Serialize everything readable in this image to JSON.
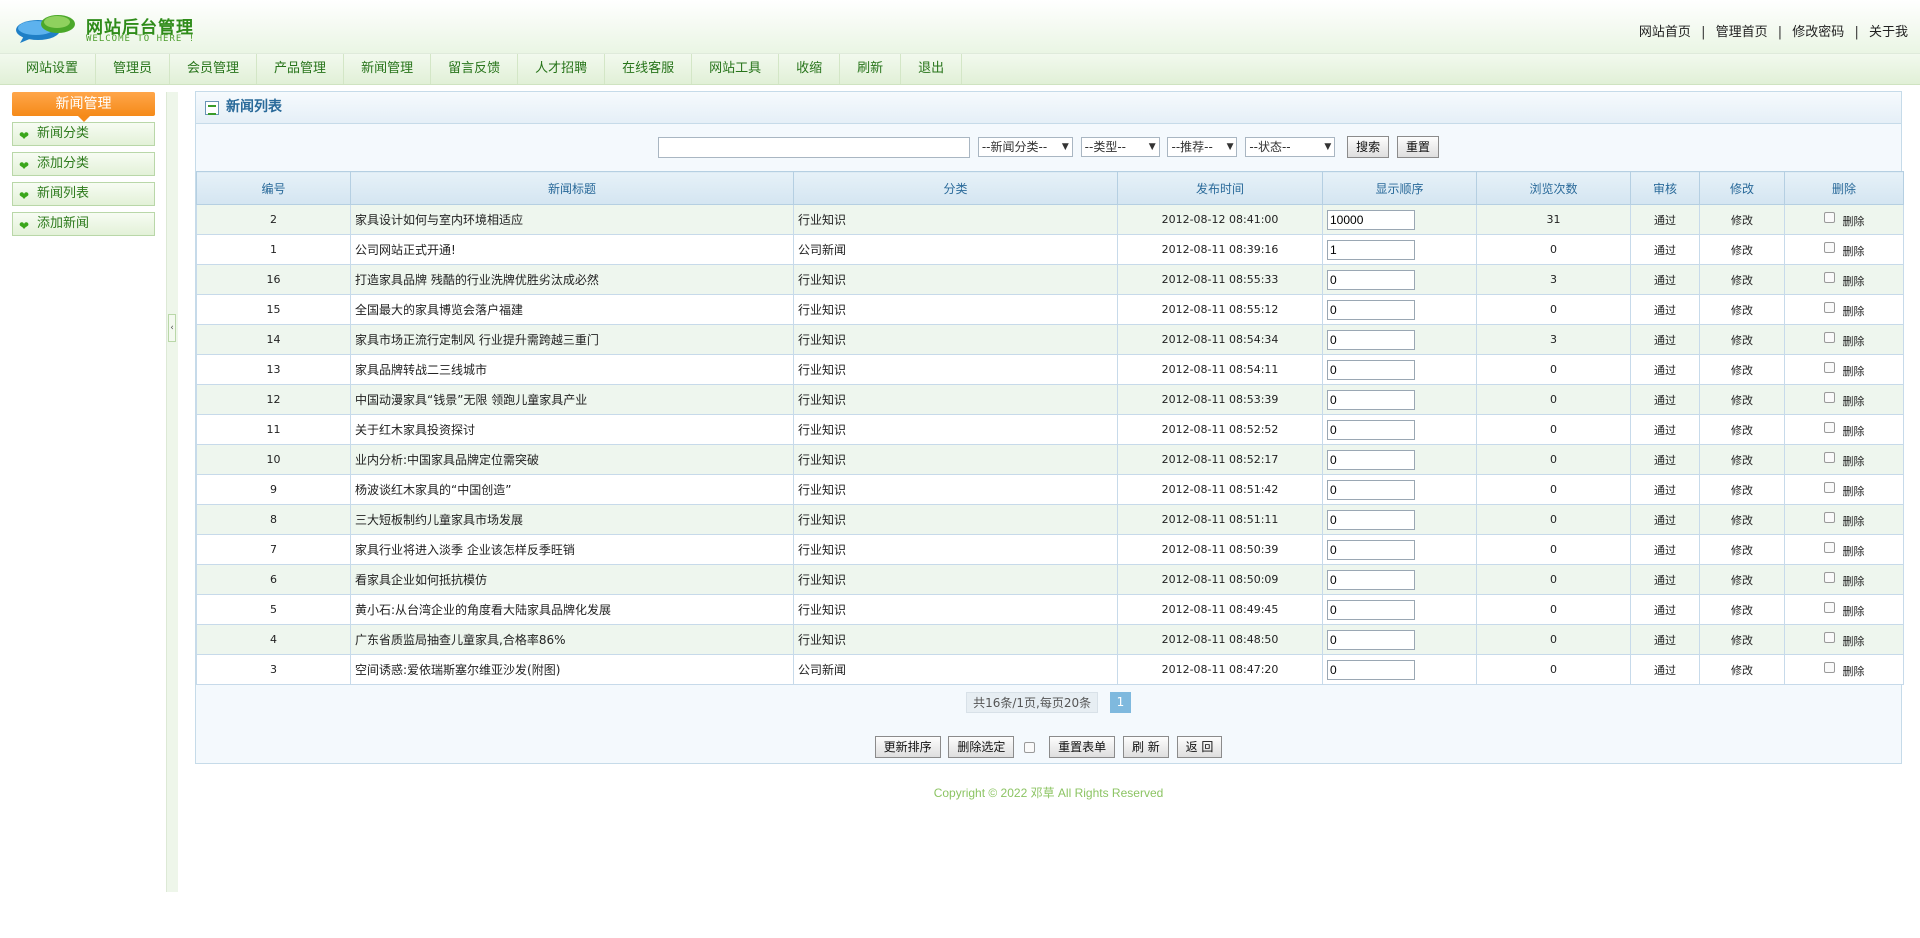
{
  "header": {
    "title": "网站后台管理",
    "subtitle": "WELCOME TO HERE !",
    "links": [
      "网站首页",
      "管理首页",
      "修改密码",
      "关于我"
    ],
    "separator": "|"
  },
  "nav": [
    "网站设置",
    "管理员",
    "会员管理",
    "产品管理",
    "新闻管理",
    "留言反馈",
    "人才招聘",
    "在线客服",
    "网站工具",
    "收缩",
    "刷新",
    "退出"
  ],
  "sidebar": {
    "title": "新闻管理",
    "items": [
      "新闻分类",
      "添加分类",
      "新闻列表",
      "添加新闻"
    ],
    "collapse_glyph": "‹"
  },
  "panel": {
    "title": "新闻列表"
  },
  "search": {
    "keyword": "",
    "category": "--新闻分类--",
    "type": "--类型--",
    "recommend": "--推荐--",
    "status": "--状态--",
    "search_label": "搜索",
    "reset_label": "重置"
  },
  "table": {
    "headers": [
      "编号",
      "新闻标题",
      "分类",
      "发布时间",
      "显示顺序",
      "浏览次数",
      "审核",
      "修改",
      "删除"
    ],
    "rows": [
      {
        "id": "2",
        "title": "家具设计如何与室内环境相适应",
        "category": "行业知识",
        "time": "2012-08-12 08:41:00",
        "order": "10000",
        "views": "31",
        "audit": "通过",
        "edit": "修改",
        "delete": "删除"
      },
      {
        "id": "1",
        "title": "公司网站正式开通!",
        "category": "公司新闻",
        "time": "2012-08-11 08:39:16",
        "order": "1",
        "views": "0",
        "audit": "通过",
        "edit": "修改",
        "delete": "删除"
      },
      {
        "id": "16",
        "title": "打造家具品牌 残酷的行业洗牌优胜劣汰成必然",
        "category": "行业知识",
        "time": "2012-08-11 08:55:33",
        "order": "0",
        "views": "3",
        "audit": "通过",
        "edit": "修改",
        "delete": "删除"
      },
      {
        "id": "15",
        "title": "全国最大的家具博览会落户福建",
        "category": "行业知识",
        "time": "2012-08-11 08:55:12",
        "order": "0",
        "views": "0",
        "audit": "通过",
        "edit": "修改",
        "delete": "删除"
      },
      {
        "id": "14",
        "title": "家具市场正流行定制风 行业提升需跨越三重门",
        "category": "行业知识",
        "time": "2012-08-11 08:54:34",
        "order": "0",
        "views": "3",
        "audit": "通过",
        "edit": "修改",
        "delete": "删除"
      },
      {
        "id": "13",
        "title": "家具品牌转战二三线城市",
        "category": "行业知识",
        "time": "2012-08-11 08:54:11",
        "order": "0",
        "views": "0",
        "audit": "通过",
        "edit": "修改",
        "delete": "删除"
      },
      {
        "id": "12",
        "title": "中国动漫家具“钱景”无限 领跑儿童家具产业",
        "category": "行业知识",
        "time": "2012-08-11 08:53:39",
        "order": "0",
        "views": "0",
        "audit": "通过",
        "edit": "修改",
        "delete": "删除"
      },
      {
        "id": "11",
        "title": "关于红木家具投资探讨",
        "category": "行业知识",
        "time": "2012-08-11 08:52:52",
        "order": "0",
        "views": "0",
        "audit": "通过",
        "edit": "修改",
        "delete": "删除"
      },
      {
        "id": "10",
        "title": "业内分析:中国家具品牌定位需突破",
        "category": "行业知识",
        "time": "2012-08-11 08:52:17",
        "order": "0",
        "views": "0",
        "audit": "通过",
        "edit": "修改",
        "delete": "删除"
      },
      {
        "id": "9",
        "title": "杨波谈红木家具的“中国创造”",
        "category": "行业知识",
        "time": "2012-08-11 08:51:42",
        "order": "0",
        "views": "0",
        "audit": "通过",
        "edit": "修改",
        "delete": "删除"
      },
      {
        "id": "8",
        "title": "三大短板制约儿童家具市场发展",
        "category": "行业知识",
        "time": "2012-08-11 08:51:11",
        "order": "0",
        "views": "0",
        "audit": "通过",
        "edit": "修改",
        "delete": "删除"
      },
      {
        "id": "7",
        "title": "家具行业将进入淡季 企业该怎样反季旺销",
        "category": "行业知识",
        "time": "2012-08-11 08:50:39",
        "order": "0",
        "views": "0",
        "audit": "通过",
        "edit": "修改",
        "delete": "删除"
      },
      {
        "id": "6",
        "title": "看家具企业如何抵抗模仿",
        "category": "行业知识",
        "time": "2012-08-11 08:50:09",
        "order": "0",
        "views": "0",
        "audit": "通过",
        "edit": "修改",
        "delete": "删除"
      },
      {
        "id": "5",
        "title": "黄小石:从台湾企业的角度看大陆家具品牌化发展",
        "category": "行业知识",
        "time": "2012-08-11 08:49:45",
        "order": "0",
        "views": "0",
        "audit": "通过",
        "edit": "修改",
        "delete": "删除"
      },
      {
        "id": "4",
        "title": "广东省质监局抽查儿童家具,合格率86%",
        "category": "行业知识",
        "time": "2012-08-11 08:48:50",
        "order": "0",
        "views": "0",
        "audit": "通过",
        "edit": "修改",
        "delete": "删除"
      },
      {
        "id": "3",
        "title": "空间诱惑:爱依瑞斯塞尔维亚沙发(附图)",
        "category": "公司新闻",
        "time": "2012-08-11 08:47:20",
        "order": "0",
        "views": "0",
        "audit": "通过",
        "edit": "修改",
        "delete": "删除"
      }
    ]
  },
  "pager": {
    "info": "共16条/1页,每页20条",
    "current": "1"
  },
  "actions": {
    "update_order": "更新排序",
    "delete_selected": "删除选定",
    "reset_form": "重置表单",
    "refresh": "刷 新",
    "back": "返 回"
  },
  "footer": {
    "copyright": "Copyright © 2022  邓草  All Rights Reserved"
  },
  "colors": {
    "brand_green": "#2f8c1a",
    "sidebar_orange": "#f58a19",
    "table_header_blue": "#2a6a9a",
    "footer_green": "#8cc463"
  }
}
